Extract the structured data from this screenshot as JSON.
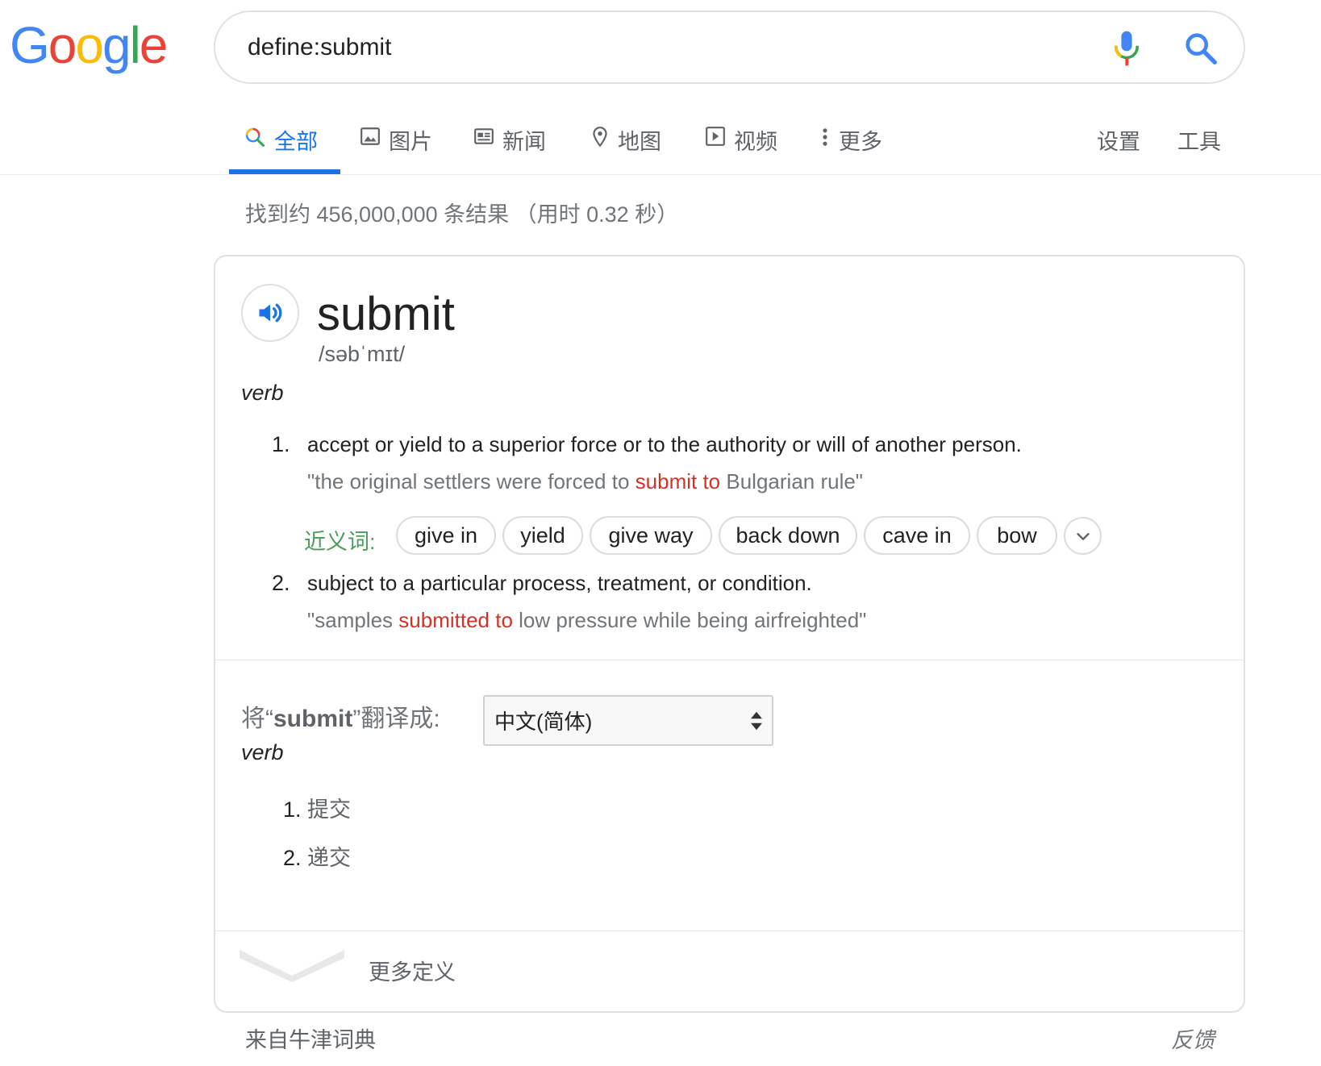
{
  "logo": {
    "letters": [
      {
        "char": "G",
        "color": "#4285f4"
      },
      {
        "char": "o",
        "color": "#ea4335"
      },
      {
        "char": "o",
        "color": "#fbbc05"
      },
      {
        "char": "g",
        "color": "#4285f4"
      },
      {
        "char": "l",
        "color": "#34a853"
      },
      {
        "char": "e",
        "color": "#ea4335"
      }
    ]
  },
  "search": {
    "query": "define:submit",
    "mic_icon": "mic-icon",
    "search_icon": "search-icon"
  },
  "tabs": [
    {
      "label": "全部",
      "icon": "search-icon",
      "active": true
    },
    {
      "label": "图片",
      "icon": "image-icon",
      "active": false
    },
    {
      "label": "新闻",
      "icon": "news-icon",
      "active": false
    },
    {
      "label": "地图",
      "icon": "map-pin-icon",
      "active": false
    },
    {
      "label": "视频",
      "icon": "video-icon",
      "active": false
    },
    {
      "label": "更多",
      "icon": "more-vert-icon",
      "active": false
    }
  ],
  "tools": {
    "settings": "设置",
    "tools": "工具"
  },
  "result_stats": "找到约 456,000,000 条结果 （用时 0.32 秒）",
  "definition": {
    "word": "submit",
    "phonetic": "/səbˈmɪt/",
    "part_of_speech": "verb",
    "senses": [
      {
        "number": "1.",
        "definition": "accept or yield to a superior force or to the authority or will of another person.",
        "example_before": "\"the original settlers were forced to ",
        "example_highlight": "submit to",
        "example_after": " Bulgarian rule\""
      },
      {
        "number": "2.",
        "definition": "subject to a particular process, treatment, or condition.",
        "example_before": "\"samples ",
        "example_highlight": "submitted to",
        "example_after": " low pressure while being airfreighted\""
      }
    ],
    "synonyms_label": "近义词:",
    "synonyms": [
      "give in",
      "yield",
      "give way",
      "back down",
      "cave in",
      "bow"
    ]
  },
  "translation": {
    "label_before": "将“",
    "label_word": "submit",
    "label_after": "”翻译成:",
    "language": "中文(简体)",
    "part_of_speech": "verb",
    "items": [
      {
        "number": "1.",
        "text": "提交"
      },
      {
        "number": "2.",
        "text": "递交"
      }
    ]
  },
  "more_definitions": "更多定义",
  "source": "来自牛津词典",
  "feedback": "反馈",
  "colors": {
    "accent": "#1a73e8",
    "highlight": "#d93025",
    "synonym_label": "#4b9b5a"
  }
}
